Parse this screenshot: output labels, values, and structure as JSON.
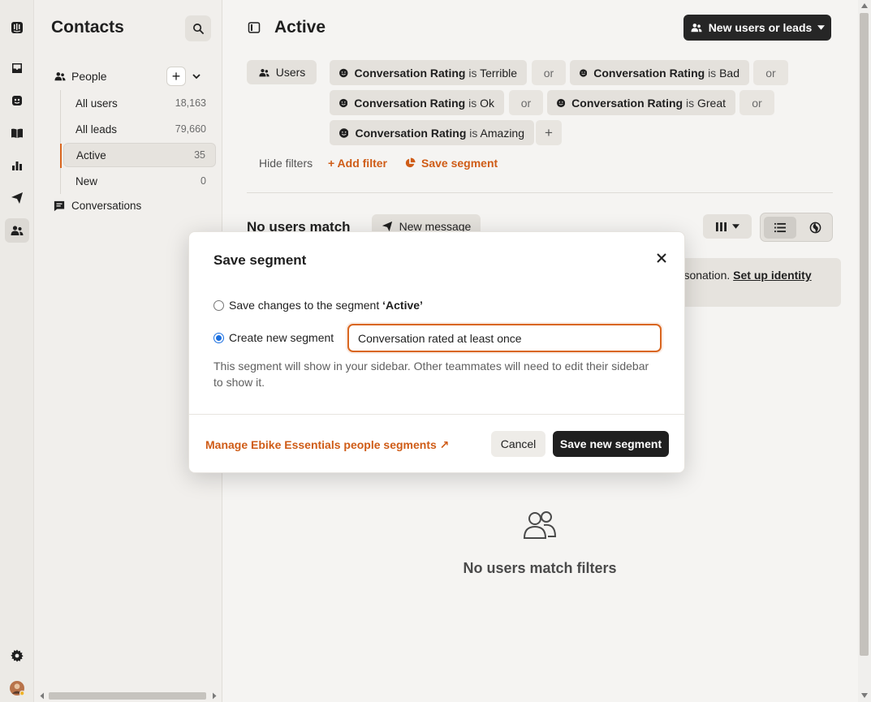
{
  "rail": {
    "icons": [
      "intercom-logo-icon",
      "inbox-icon",
      "fin-ai-icon",
      "knowledge-book-icon",
      "reports-chart-icon",
      "outbound-send-icon",
      "contacts-people-icon",
      "settings-gear-icon",
      "user-avatar"
    ]
  },
  "sidebar": {
    "title": "Contacts",
    "people_label": "People",
    "items": [
      {
        "label": "All users",
        "count": "18,163"
      },
      {
        "label": "All leads",
        "count": "79,660"
      },
      {
        "label": "Active",
        "count": "35"
      },
      {
        "label": "New",
        "count": "0"
      }
    ],
    "conversations_label": "Conversations"
  },
  "header": {
    "title": "Active",
    "segment_button": "New users or leads"
  },
  "filters": {
    "users_chip": "Users",
    "attribute": "Conversation Rating",
    "operator": "is",
    "values": [
      "Terrible",
      "Bad",
      "Ok",
      "Great",
      "Amazing"
    ],
    "or_label": "or",
    "add_label": "+",
    "hide_filters": "Hide filters",
    "add_filter": "+ Add filter",
    "save_segment": "Save segment"
  },
  "results": {
    "heading": "No users match",
    "new_message": "New message",
    "banner_text": "ersonation.",
    "banner_link": "Set up identity",
    "empty_text": "No users match filters"
  },
  "modal": {
    "title": "Save segment",
    "option_save_changes_prefix": "Save changes to the segment ",
    "option_save_changes_segment": "‘Active’",
    "option_create_new": "Create new segment",
    "input_value": "Conversation rated at least once",
    "help_text": "This segment will show in your sidebar. Other teammates will need to edit their sidebar to show it.",
    "manage_link": "Manage Ebike Essentials people segments ↗",
    "cancel": "Cancel",
    "save": "Save new segment"
  },
  "colors": {
    "accent": "#cf5c17",
    "primary_button": "#1f1f1f",
    "radio_checked": "#1a6fe0"
  }
}
